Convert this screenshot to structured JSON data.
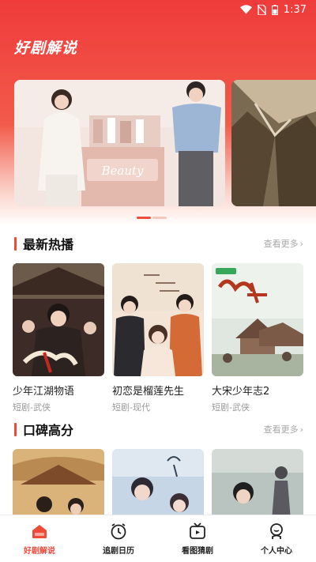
{
  "status_bar": {
    "time": "1:37"
  },
  "header": {
    "title": "好剧解说"
  },
  "banner": {
    "main_sign_text": "Beauty",
    "dots_count": 2,
    "active_dot": 0
  },
  "sections": [
    {
      "title": "最新热播",
      "more_label": "查看更多",
      "items": [
        {
          "title": "少年江湖物语",
          "subtitle": "短剧-武侠"
        },
        {
          "title": "初恋是榴莲先生",
          "subtitle": "短剧-现代"
        },
        {
          "title": "大宋少年志2",
          "subtitle": "短剧-武侠"
        }
      ]
    },
    {
      "title": "口碑高分",
      "more_label": "查看更多",
      "items": [
        {},
        {},
        {}
      ]
    }
  ],
  "bottom_nav": [
    {
      "label": "好剧解说",
      "icon": "home-icon",
      "active": true
    },
    {
      "label": "追剧日历",
      "icon": "clock-icon",
      "active": false
    },
    {
      "label": "看图猜剧",
      "icon": "tv-icon",
      "active": false
    },
    {
      "label": "个人中心",
      "icon": "person-icon",
      "active": false
    }
  ],
  "colors": {
    "accent": "#f04a3a",
    "header_top": "#ef3b3b"
  }
}
